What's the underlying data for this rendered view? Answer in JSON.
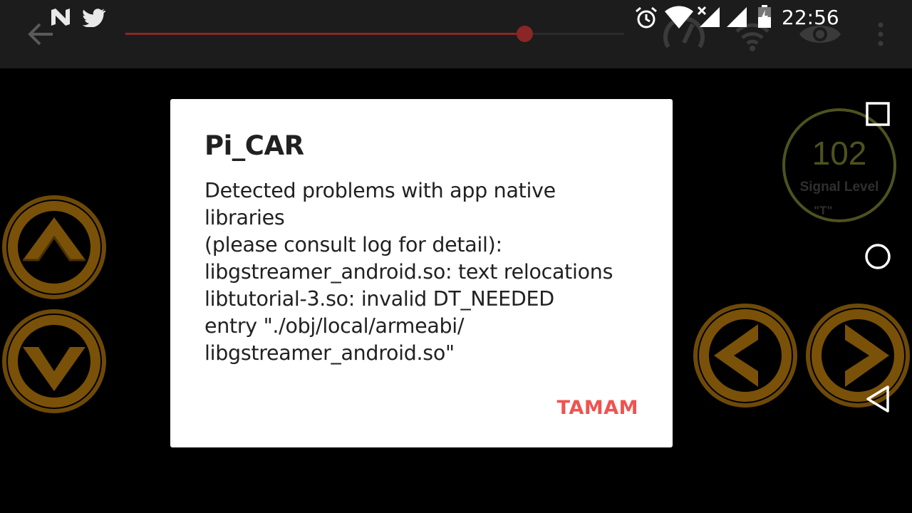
{
  "status_bar": {
    "time": "22:56",
    "notification_icons": [
      "n-app-icon",
      "twitter-icon"
    ],
    "system_icons": [
      "alarm-icon",
      "wifi-signal-icon",
      "cellular-signal-icon",
      "battery-charging-icon"
    ]
  },
  "player": {
    "seek_progress": 0.8,
    "toolbar_icons": [
      "back-arrow-icon",
      "speedometer-icon",
      "wifi-icon",
      "eye-icon",
      "overflow-menu-icon"
    ],
    "accent_color": "#8b2626"
  },
  "car_controls": {
    "buttons": [
      "forward-button",
      "backward-button",
      "left-button",
      "right-button"
    ],
    "color": "#7a4f08"
  },
  "signal_gauge": {
    "value": "102",
    "label": "Signal Level",
    "unit": "\"T\"",
    "color": "#4e521e"
  },
  "nav_bar": {
    "buttons": [
      "recents-button",
      "home-button",
      "back-button"
    ]
  },
  "dialog": {
    "title": "Pi_CAR",
    "message": "Detected problems with app native\nlibraries\n(please consult log for detail):\nlibgstreamer_android.so: text relocations\nlibtutorial-3.so: invalid DT_NEEDED\nentry \"./obj/local/armeabi/\nlibgstreamer_android.so\"",
    "ok_label": "TAMAM",
    "ok_color": "#ef5350"
  }
}
